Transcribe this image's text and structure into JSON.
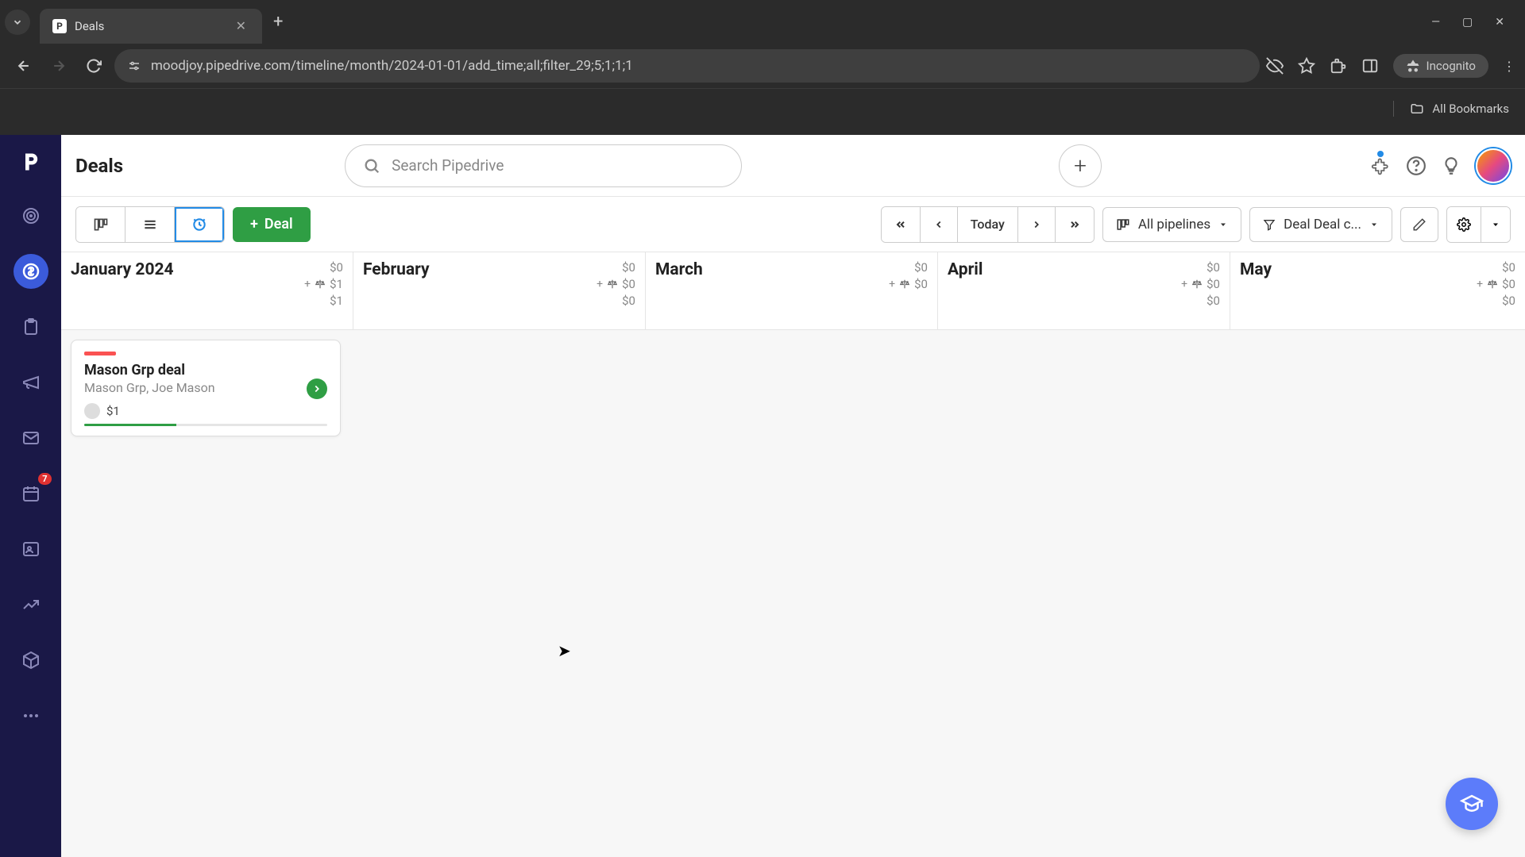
{
  "browser": {
    "tab_title": "Deals",
    "url": "moodjoy.pipedrive.com/timeline/month/2024-01-01/add_time;all;filter_29;5;1;1;1",
    "incognito_label": "Incognito",
    "all_bookmarks": "All Bookmarks"
  },
  "sidebar": {
    "badge": "7"
  },
  "header": {
    "title": "Deals",
    "search_placeholder": "Search Pipedrive"
  },
  "toolbar": {
    "deal_button": "Deal",
    "today_label": "Today",
    "pipeline_label": "All pipelines",
    "filter_label": "Deal Deal c..."
  },
  "months": [
    {
      "name": "January 2024",
      "top": "$0",
      "mid": "$1",
      "bot": "$1"
    },
    {
      "name": "February",
      "top": "$0",
      "mid": "$0",
      "bot": "$0"
    },
    {
      "name": "March",
      "top": "$0",
      "mid": "$0",
      "bot": ""
    },
    {
      "name": "April",
      "top": "$0",
      "mid": "$0",
      "bot": "$0"
    },
    {
      "name": "May",
      "top": "$0",
      "mid": "$0",
      "bot": "$0"
    }
  ],
  "deal": {
    "title": "Mason Grp deal",
    "subtitle": "Mason Grp, Joe Mason",
    "amount": "$1"
  }
}
